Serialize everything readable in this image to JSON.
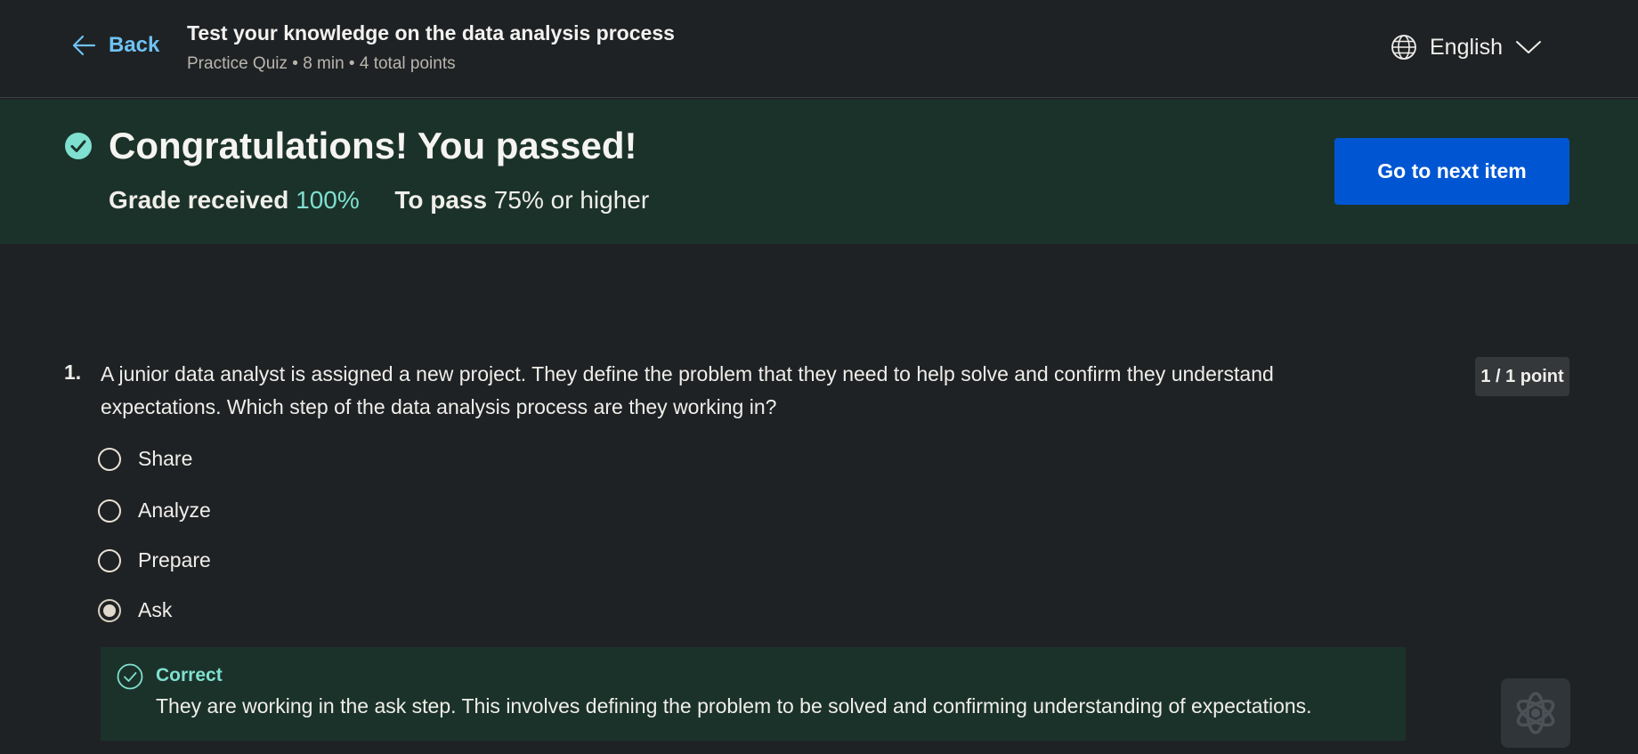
{
  "header": {
    "back_label": "Back",
    "quiz_title": "Test your knowledge on the data analysis process",
    "quiz_meta": "Practice Quiz • 8 min • 4 total points",
    "language": "English"
  },
  "banner": {
    "congrats": "Congratulations! You passed!",
    "grade_label": "Grade received",
    "grade_value": "100%",
    "pass_label": "To pass",
    "pass_value": "75% or higher",
    "next_button": "Go to next item"
  },
  "question": {
    "number": "1.",
    "text": "A junior data analyst is assigned a new project. They define the problem that they need to help solve and confirm they understand expectations. Which step of the data analysis process are they working in?",
    "points": "1 / 1 point",
    "options": [
      {
        "label": "Share",
        "selected": false
      },
      {
        "label": "Analyze",
        "selected": false
      },
      {
        "label": "Prepare",
        "selected": false
      },
      {
        "label": "Ask",
        "selected": true
      }
    ],
    "feedback": {
      "label": "Correct",
      "text": "They are working in the ask step. This involves defining the problem to be solved and confirming understanding of expectations."
    }
  },
  "colors": {
    "accent_blue": "#0056d2",
    "success_green": "#7fe0cf",
    "link_blue": "#6ec3f4"
  },
  "icons": {
    "back": "arrow-left-icon",
    "language": "globe-icon",
    "dropdown": "chevron-down-icon",
    "passed": "check-circle-icon",
    "correct": "check-circle-outline-icon",
    "assistant": "ai-assistant-icon"
  }
}
